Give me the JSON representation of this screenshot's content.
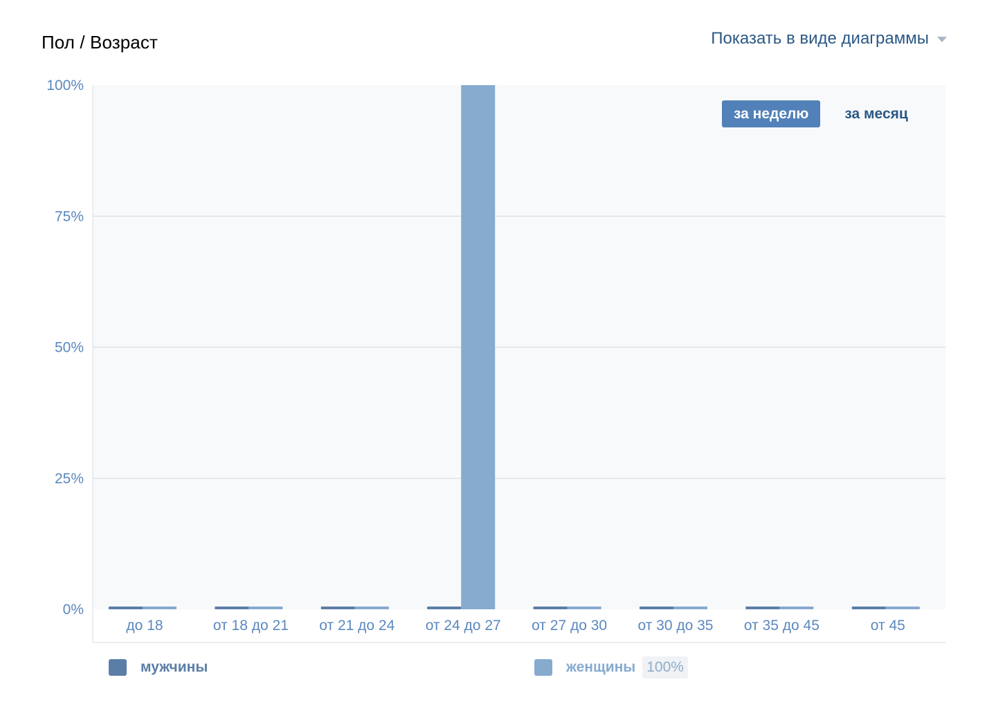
{
  "header": {
    "title": "Пол / Возраст",
    "view_select_label": "Показать в виде диаграммы"
  },
  "period": {
    "week_label": "за неделю",
    "month_label": "за месяц",
    "active": "week"
  },
  "colors": {
    "men": "#5b7ea6",
    "women": "#87aacf",
    "plot_bg": "#f8f9fb",
    "grid": "#dde2e8",
    "axis_text": "#5b88bd",
    "active_button": "#5181b8",
    "link": "#2a5885"
  },
  "legend": {
    "men_label": "мужчины",
    "women_label": "женщины",
    "women_value": "100%"
  },
  "chart_data": {
    "type": "bar",
    "categories": [
      "до 18",
      "от 18 до 21",
      "от 21 до 24",
      "от 24 до 27",
      "от 27 до 30",
      "от 30 до 35",
      "от 35 до 45",
      "от 45"
    ],
    "series": [
      {
        "name": "мужчины",
        "values": [
          0,
          0,
          0,
          0,
          0,
          0,
          0,
          0
        ]
      },
      {
        "name": "женщины",
        "values": [
          0,
          0,
          0,
          100,
          0,
          0,
          0,
          0
        ]
      }
    ],
    "y_ticks": [
      "0%",
      "25%",
      "50%",
      "75%",
      "100%"
    ],
    "ylim": [
      0,
      100
    ],
    "grid": true,
    "legend_position": "bottom"
  }
}
